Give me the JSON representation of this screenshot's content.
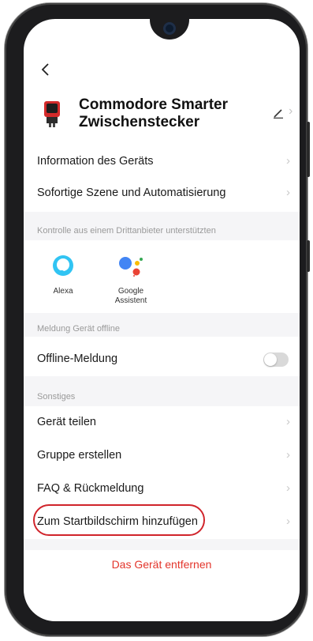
{
  "nav": {
    "back_icon": "chevron-left-icon"
  },
  "device": {
    "name": "Commodore Smarter Zwischenstecker",
    "icon": "smart-plug-icon",
    "edit_icon": "pencil-icon"
  },
  "menu_top": [
    {
      "label": "Information des Geräts"
    },
    {
      "label": "Sofortige Szene und Automatisierung"
    }
  ],
  "third_party": {
    "title": "Kontrolle aus einem Drittanbieter unterstützten",
    "items": [
      {
        "label": "Alexa",
        "icon": "alexa-icon"
      },
      {
        "label_line1": "Google",
        "label_line2": "Assistent",
        "icon": "google-assistant-icon"
      }
    ]
  },
  "offline": {
    "title": "Meldung Gerät offline",
    "label": "Offline-Meldung",
    "enabled": false
  },
  "other": {
    "title": "Sonstiges",
    "items": [
      {
        "label": "Gerät teilen"
      },
      {
        "label": "Gruppe erstellen"
      },
      {
        "label": "FAQ & Rückmeldung"
      },
      {
        "label": "Zum Startbildschirm hinzufügen"
      }
    ]
  },
  "remove_label": "Das Gerät entfernen",
  "colors": {
    "accent_red": "#e3352b",
    "highlight_red": "#d0242b",
    "section_bg": "#f5f5f7",
    "alexa_blue": "#31c4f3"
  }
}
